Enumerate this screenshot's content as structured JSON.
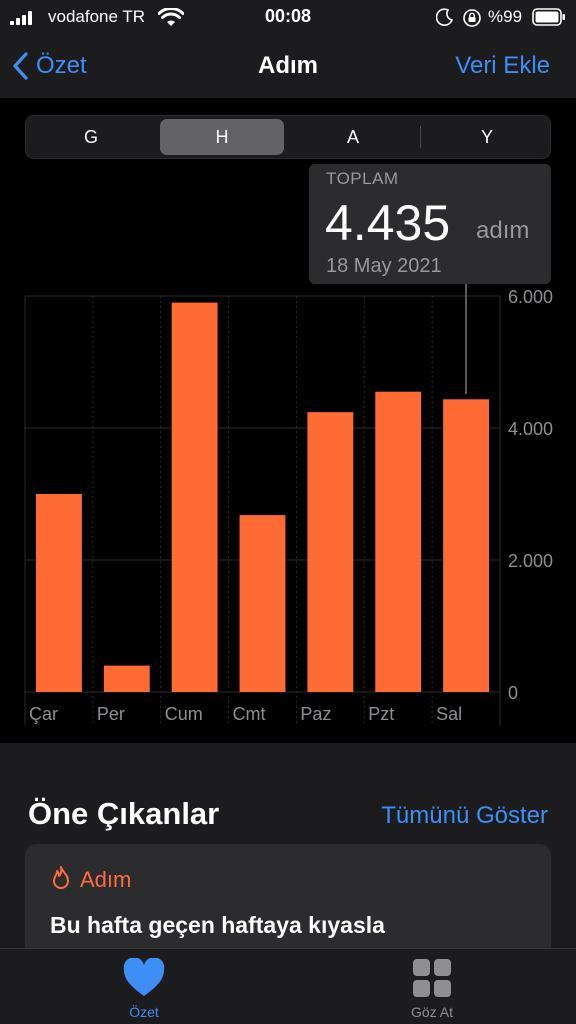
{
  "status_bar": {
    "carrier": "vodafone TR",
    "time": "00:08",
    "battery": "%99",
    "icons": [
      "signal-icon",
      "wifi-icon",
      "moon-icon",
      "orientation-lock-icon",
      "battery-icon"
    ]
  },
  "nav": {
    "back_label": "Özet",
    "title": "Adım",
    "action_label": "Veri Ekle"
  },
  "segments": {
    "options": [
      "G",
      "H",
      "A",
      "Y"
    ],
    "selected": "H"
  },
  "tooltip": {
    "label": "TOPLAM",
    "value": "4.435",
    "unit": "adım",
    "date": "18 May 2021"
  },
  "chart_data": {
    "type": "bar",
    "categories": [
      "Çar",
      "Per",
      "Cum",
      "Cmt",
      "Paz",
      "Pzt",
      "Sal"
    ],
    "values": [
      3000,
      400,
      5900,
      2680,
      4240,
      4550,
      4435
    ],
    "ylim": [
      0,
      6000
    ],
    "y_ticks": [
      0,
      2000,
      4000,
      6000
    ],
    "y_tick_labels": [
      "0",
      "2.000",
      "4.000",
      "6.000"
    ],
    "selected_category": "Sal",
    "bar_color": "#ff6b35",
    "grid": true
  },
  "highlights": {
    "title": "Öne Çıkanlar",
    "show_all": "Tümünü Göster",
    "card": {
      "category": "Adım",
      "icon": "flame-icon",
      "text": "Bu hafta geçen haftaya kıyasla"
    }
  },
  "tab_bar": {
    "tabs": [
      {
        "label": "Özet",
        "icon": "heart-icon",
        "active": true
      },
      {
        "label": "Göz At",
        "icon": "grid-icon",
        "active": false
      }
    ]
  },
  "colors": {
    "accent": "#3d8ff6",
    "bar": "#ff6b35",
    "background": "#000000",
    "surface": "#1c1c1e"
  }
}
